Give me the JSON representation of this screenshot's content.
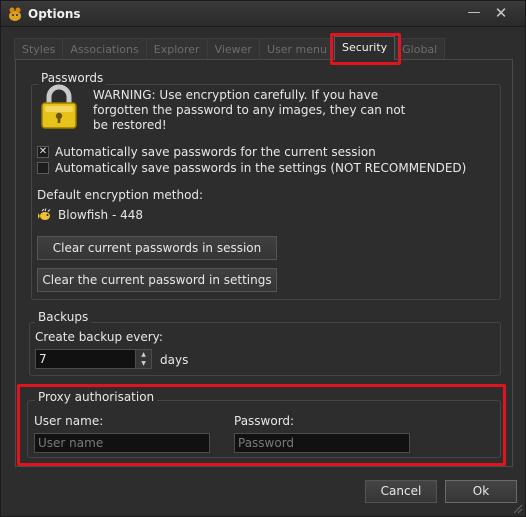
{
  "window": {
    "title": "Options",
    "minimize_glyph": "—",
    "close_glyph": "✕",
    "icon": "app-icon"
  },
  "tabs": [
    {
      "label": "Styles",
      "active": false
    },
    {
      "label": "Associations",
      "active": false
    },
    {
      "label": "Explorer",
      "active": false
    },
    {
      "label": "Viewer",
      "active": false
    },
    {
      "label": "User menu",
      "active": false
    },
    {
      "label": "Security",
      "active": true
    },
    {
      "label": "Global",
      "active": false
    }
  ],
  "passwords": {
    "group_label": "Passwords",
    "warning_text": "WARNING: Use encryption carefully. If you have forgotten the password to any images, they can not be restored!",
    "auto_save_session": {
      "label": "Automatically save passwords for the current session",
      "checked": true,
      "mark": "✕"
    },
    "auto_save_settings": {
      "label": "Automatically save passwords in the settings (NOT RECOMMENDED)",
      "checked": false
    },
    "method_label": "Default encryption method:",
    "method_value": "Blowfish - 448",
    "clear_session_button": "Clear current passwords in session",
    "clear_settings_button": "Clear the current password in settings"
  },
  "backups": {
    "group_label": "Backups",
    "create_label": "Create backup every:",
    "value": "7",
    "unit": "days",
    "up_glyph": "▲",
    "down_glyph": "▼"
  },
  "proxy": {
    "group_label": "Proxy authorisation",
    "username_label": "User name:",
    "username_placeholder": "User name",
    "password_label": "Password:",
    "password_placeholder": "Password"
  },
  "footer": {
    "cancel_label": "Cancel",
    "ok_label": "Ok"
  },
  "colors": {
    "highlight": "#e0141e",
    "background": "#2d2d2d",
    "input_bg": "#111111",
    "text": "#e8e8e8"
  }
}
